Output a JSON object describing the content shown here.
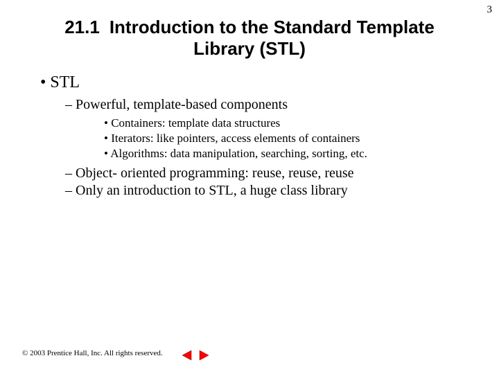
{
  "page_number": "3",
  "title_line1": "21.1",
  "title_line2": "Introduction to the Standard Template Library (STL)",
  "bullets": {
    "l1_0": "STL",
    "l2_0": "Powerful, template-based components",
    "l3_0": "Containers: template data structures",
    "l3_1": "Iterators: like pointers, access elements of containers",
    "l3_2": "Algorithms: data manipulation, searching, sorting, etc.",
    "l2_1": "Object- oriented programming: reuse, reuse, reuse",
    "l2_2": "Only an introduction to STL, a huge class library"
  },
  "footer": "© 2003 Prentice Hall, Inc.  All rights reserved."
}
